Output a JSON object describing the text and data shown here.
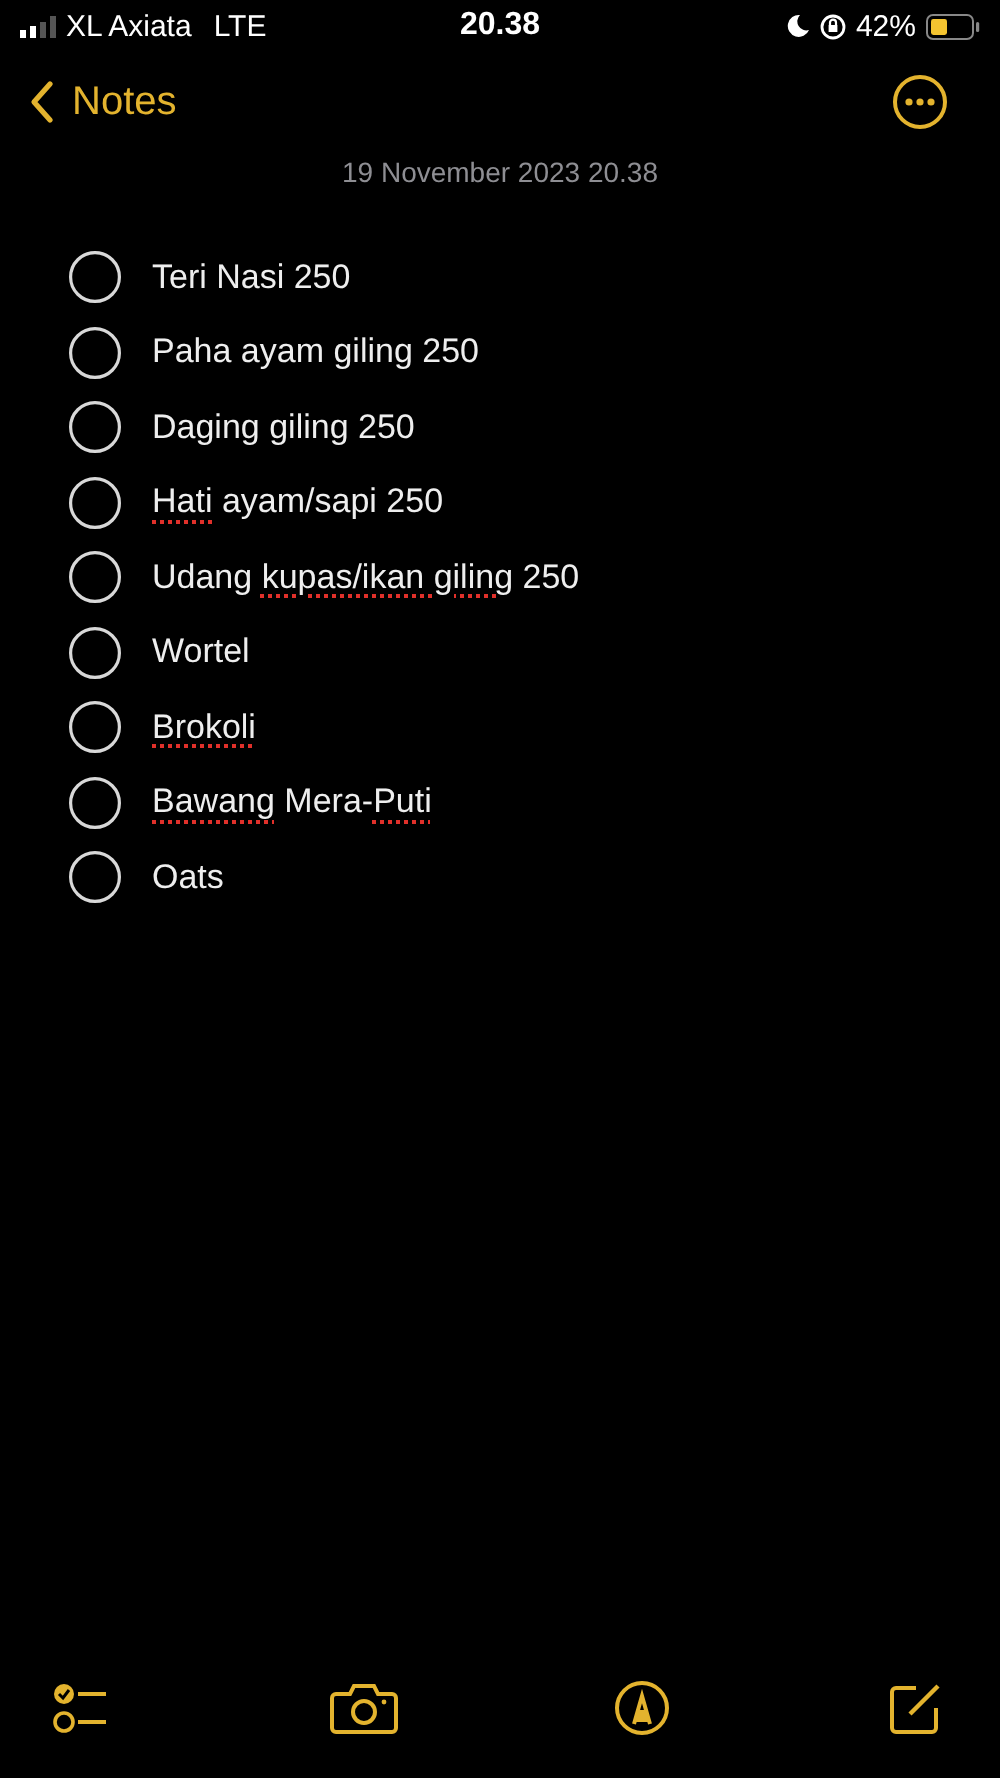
{
  "status_bar": {
    "carrier": "XL Axiata",
    "network": "LTE",
    "time": "20.38",
    "battery": "42%"
  },
  "nav": {
    "back": "Notes"
  },
  "date": "19 November 2023 20.38",
  "checklist": [
    {
      "checked": false,
      "segments": [
        {
          "text": "Teri Nasi 250",
          "flagged": false
        }
      ]
    },
    {
      "checked": false,
      "segments": [
        {
          "text": "Paha ayam giling 250",
          "flagged": false
        }
      ]
    },
    {
      "checked": false,
      "segments": [
        {
          "text": "Daging giling 250",
          "flagged": false
        }
      ]
    },
    {
      "checked": false,
      "segments": [
        {
          "text": "Hati",
          "flagged": true
        },
        {
          "text": " ayam/sapi 250",
          "flagged": false
        }
      ]
    },
    {
      "checked": false,
      "segments": [
        {
          "text": "Udang ",
          "flagged": false
        },
        {
          "text": "kupas/ikan giling",
          "flagged": true
        },
        {
          "text": " 250",
          "flagged": false
        }
      ]
    },
    {
      "checked": false,
      "segments": [
        {
          "text": "Wortel",
          "flagged": false
        }
      ]
    },
    {
      "checked": false,
      "segments": [
        {
          "text": "Brokoli",
          "flagged": true
        }
      ]
    },
    {
      "checked": false,
      "segments": [
        {
          "text": "Bawang",
          "flagged": true
        },
        {
          "text": " Mera-",
          "flagged": false
        },
        {
          "text": "Puti",
          "flagged": true
        }
      ]
    },
    {
      "checked": false,
      "segments": [
        {
          "text": "Oats",
          "flagged": false
        }
      ]
    }
  ]
}
